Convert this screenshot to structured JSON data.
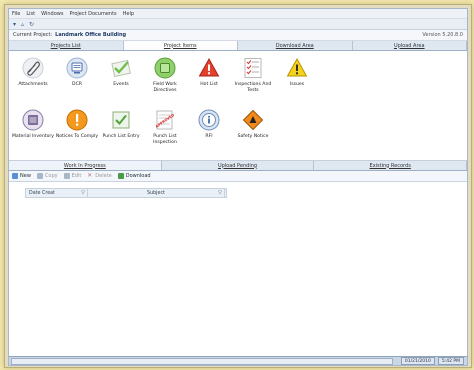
{
  "menu": [
    "File",
    "List",
    "Windows",
    "Project Documents",
    "Help"
  ],
  "toolbar_icons": [
    "filter-icon",
    "triangle-icon",
    "refresh-icon"
  ],
  "project": {
    "label": "Current Project:",
    "name": "Landmark Office Building",
    "version": "Version 5.20.8.0"
  },
  "tabs": [
    "Projects List",
    "Project Items",
    "Download Area",
    "Upload Area"
  ],
  "items_row1": [
    {
      "label": "Attachments",
      "icon": "paperclip-icon"
    },
    {
      "label": "DCR",
      "icon": "monitor-icon"
    },
    {
      "label": "Events",
      "icon": "checkmark-icon"
    },
    {
      "label": "Field Work Directives",
      "icon": "green-square-icon"
    },
    {
      "label": "Hot List",
      "icon": "warning-red-icon"
    },
    {
      "label": "Inspections And\nTests",
      "icon": "checklist-icon"
    },
    {
      "label": "Issues",
      "icon": "warning-yellow-icon"
    }
  ],
  "items_row2": [
    {
      "label": "Material Inventory",
      "icon": "inventory-icon"
    },
    {
      "label": "Notices To Comply",
      "icon": "exclamation-icon"
    },
    {
      "label": "Punch List Entry",
      "icon": "punch-entry-icon"
    },
    {
      "label": "Punch List Inspection",
      "icon": "approved-stamp-icon"
    },
    {
      "label": "RFI",
      "icon": "info-icon"
    },
    {
      "label": "Safety Notice",
      "icon": "safety-diamond-icon"
    }
  ],
  "subtabs": [
    "Work In Progress",
    "Upload Pending",
    "Existing Records"
  ],
  "actions": [
    {
      "label": "New",
      "enabled": true,
      "color": "#5b8fd4"
    },
    {
      "label": "Copy",
      "enabled": false,
      "color": "#a8b6c8"
    },
    {
      "label": "Edit",
      "enabled": false,
      "color": "#a8b6c8"
    },
    {
      "label": "Delete",
      "enabled": false,
      "color": "#b8a8a8"
    },
    {
      "label": "Download",
      "enabled": true,
      "color": "#4a9a4a"
    }
  ],
  "columns": [
    "Date Creat",
    "Subject"
  ],
  "status": {
    "date": "01/21/2010",
    "time": "5:42 PM"
  },
  "stamp_text": "APPROVED"
}
